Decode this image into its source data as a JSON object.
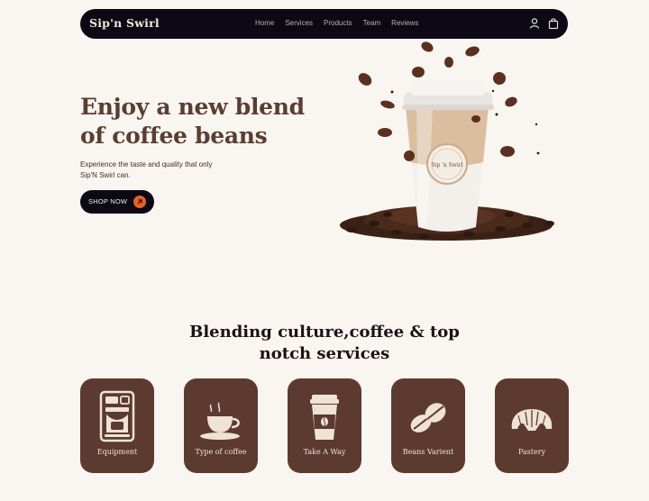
{
  "nav": {
    "brand": "Sip'n Swirl",
    "items": [
      "Home",
      "Services",
      "Products",
      "Team",
      "Reviews"
    ],
    "icons": [
      "user-icon",
      "shopping-bag-icon"
    ]
  },
  "hero": {
    "title_line1": "Enjoy a new blend",
    "title_line2": "of coffee beans",
    "subtitle": "Experience the taste and quality that only Sip'N Swirl can.",
    "button_label": "SHOP NOW",
    "button_icon": "arrow-up-right-icon",
    "cup_label": "Sip 'n Swirl"
  },
  "section": {
    "title": "Blending culture,coffee & top notch services"
  },
  "cards": [
    {
      "label": "Equipment",
      "icon": "espresso-machine-icon"
    },
    {
      "label": "Type of coffee",
      "icon": "coffee-cup-icon"
    },
    {
      "label": "Take A Way",
      "icon": "takeaway-cup-icon"
    },
    {
      "label": "Beans Varient",
      "icon": "coffee-beans-icon"
    },
    {
      "label": "Pastery",
      "icon": "croissant-icon"
    }
  ],
  "colors": {
    "background": "#f9f5f0",
    "nav_bg": "#0c0814",
    "card_bg": "#5c3a30",
    "accent": "#e3612c",
    "title_brown": "#5a3d33",
    "icon_cream": "#efe3d2"
  }
}
